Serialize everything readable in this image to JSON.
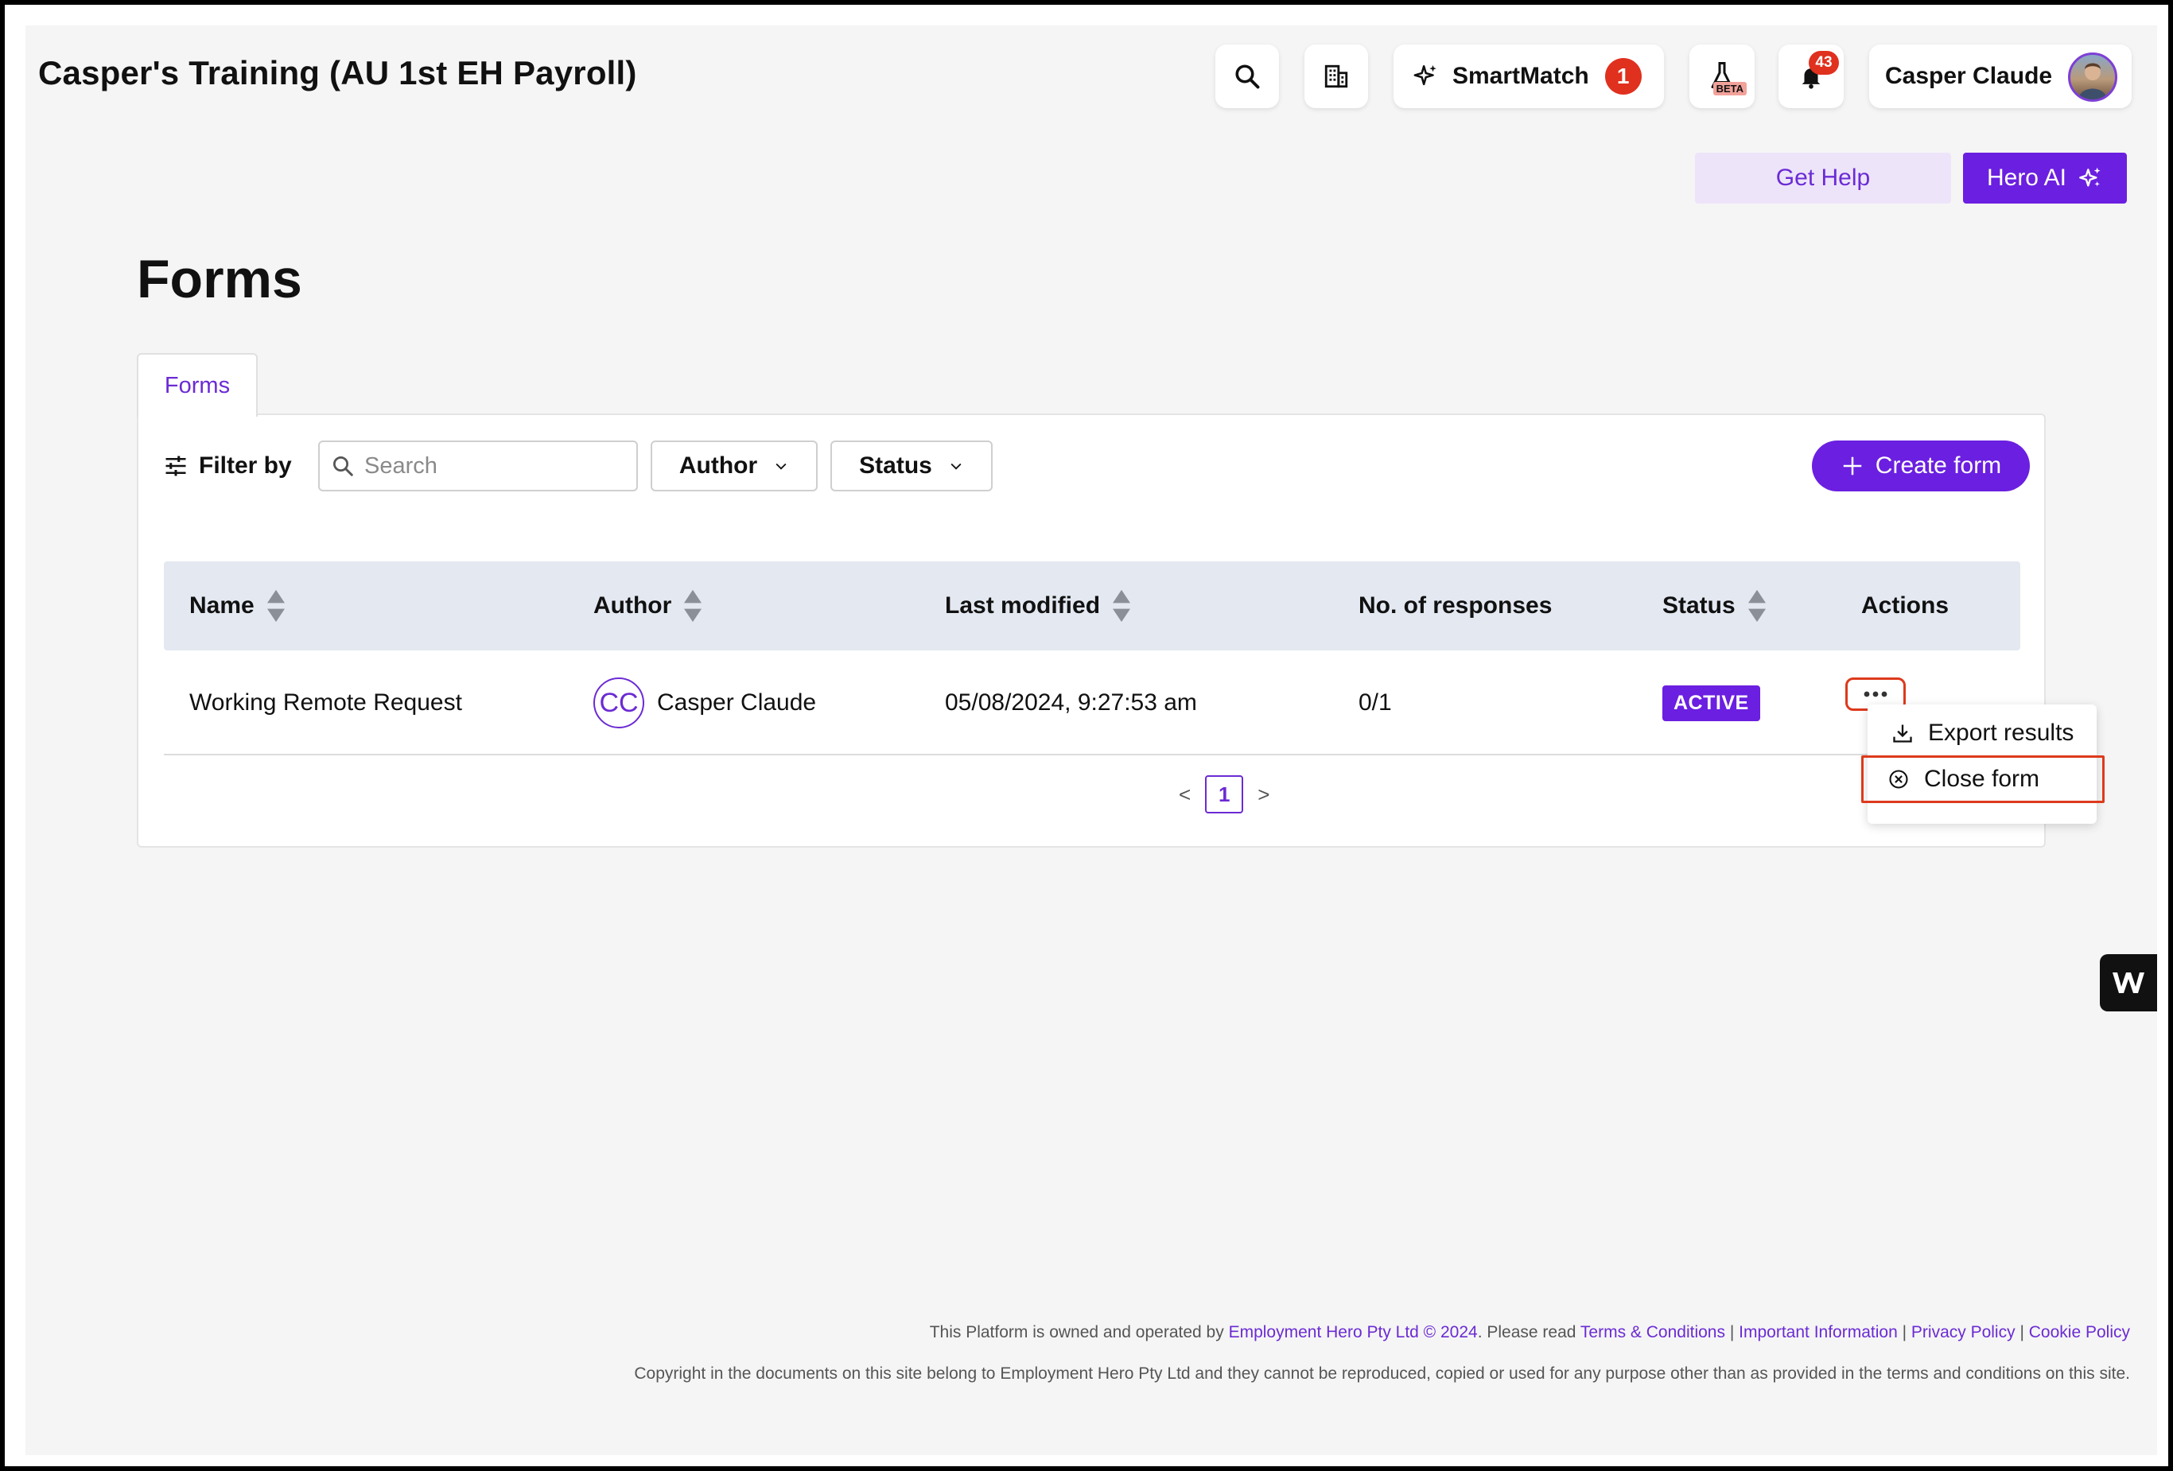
{
  "header": {
    "org_title": "Casper's Training (AU 1st EH Payroll)",
    "smartmatch_label": "SmartMatch",
    "smartmatch_count": "1",
    "beta_tag": "BETA",
    "notifications_count": "43",
    "user_name": "Casper Claude"
  },
  "actions": {
    "get_help": "Get Help",
    "hero_ai": "Hero AI"
  },
  "page": {
    "title": "Forms",
    "tab_label": "Forms"
  },
  "filters": {
    "label": "Filter by",
    "search_placeholder": "Search",
    "author_label": "Author",
    "status_label": "Status",
    "create_label": "Create form"
  },
  "table": {
    "headers": [
      "Name",
      "Author",
      "Last modified",
      "No. of responses",
      "Status",
      "Actions"
    ],
    "rows": [
      {
        "name": "Working Remote Request",
        "author_initials": "CC",
        "author": "Casper Claude",
        "last_modified": "05/08/2024, 9:27:53 am",
        "responses": "0/1",
        "status": "ACTIVE"
      }
    ]
  },
  "pagination": {
    "prev": "<",
    "current": "1",
    "next": ">"
  },
  "row_menu": {
    "export": "Export results",
    "close": "Close form"
  },
  "footer": {
    "line1_prefix": "This Platform is owned and operated by",
    "company_link": "Employment Hero Pty Ltd © 2024",
    "line1_mid": ". Please read",
    "terms": "Terms & Conditions",
    "important": "Important Information",
    "privacy": "Privacy Policy",
    "cookie": "Cookie Policy",
    "separator": "|",
    "copyright": "Copyright in the documents on this site belong to Employment Hero Pty Ltd and they cannot be reproduced, copied or used for any purpose other than as provided in the terms and conditions on this site."
  },
  "colors": {
    "brand_purple": "#6b1fe0",
    "highlight_red": "#dd3a1c",
    "badge_red": "#e0301e",
    "table_header_bg": "#e3e8f1"
  }
}
